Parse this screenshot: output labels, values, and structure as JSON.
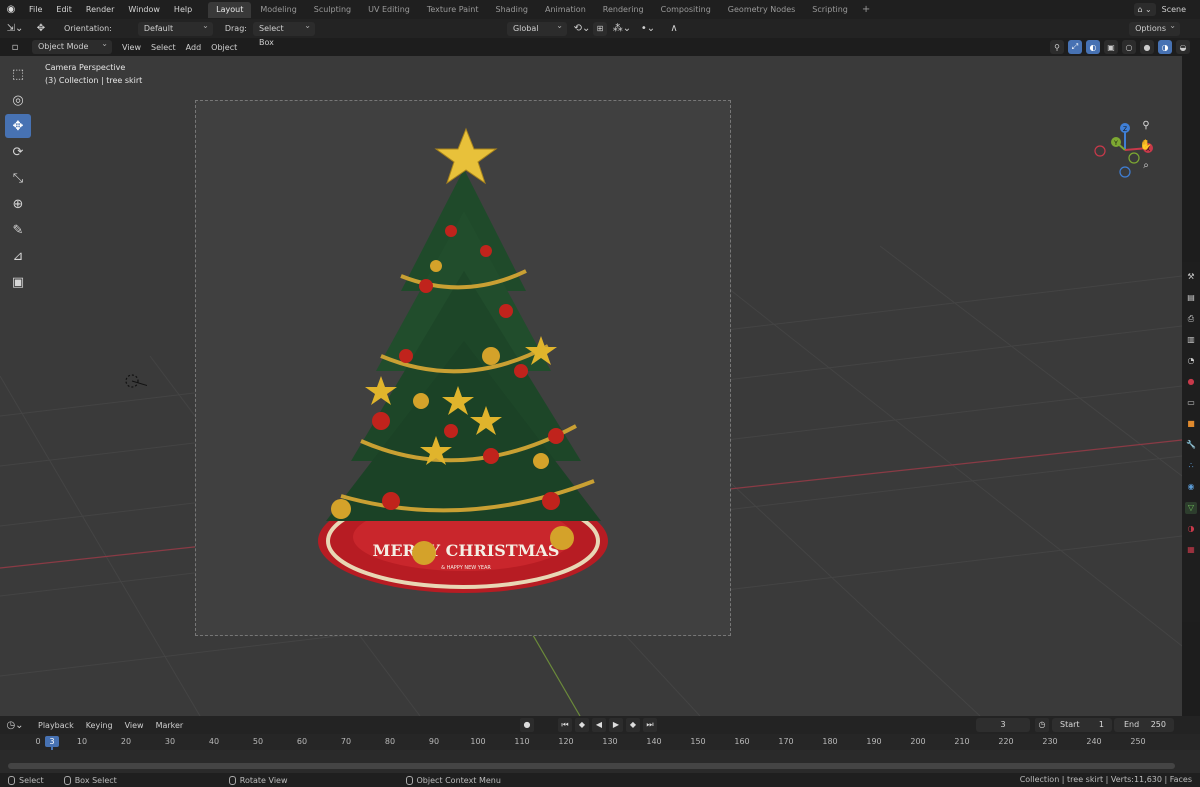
{
  "menu": {
    "items": [
      "File",
      "Edit",
      "Render",
      "Window",
      "Help"
    ]
  },
  "workspaces": {
    "tabs": [
      "Layout",
      "Modeling",
      "Sculpting",
      "UV Editing",
      "Texture Paint",
      "Shading",
      "Animation",
      "Rendering",
      "Compositing",
      "Geometry Nodes",
      "Scripting"
    ],
    "active": "Layout",
    "add": "+"
  },
  "scene": {
    "label": "Scene"
  },
  "tool_header": {
    "orientation_label": "Orientation:",
    "orientation_value": "Default",
    "drag_label": "Drag:",
    "drag_value": "Select Box",
    "transform_space": "Global",
    "options": "Options"
  },
  "viewport_header": {
    "mode": "Object Mode",
    "menus": [
      "View",
      "Select",
      "Add",
      "Object"
    ]
  },
  "viewport": {
    "camera_label": "Camera Perspective",
    "collection_label": "(3) Collection | tree skirt",
    "skirt_text": "MERRY CHRISTMAS",
    "skirt_subtext": "& HAPPY NEW YEAR"
  },
  "toolbar": {
    "tools": [
      "select-box-icon",
      "cursor-icon",
      "move-icon",
      "rotate-icon",
      "scale-icon",
      "transform-icon",
      "annotate-icon",
      "measure-icon",
      "add-cube-icon"
    ],
    "active": "move-icon"
  },
  "gizmo": {
    "x": "X",
    "y": "Y",
    "z": "Z"
  },
  "timeline": {
    "menus": [
      "Playback",
      "Keying",
      "View",
      "Marker"
    ],
    "current_frame": "3",
    "start_label": "Start",
    "start_value": "1",
    "end_label": "End",
    "end_value": "250",
    "ticks": [
      "0",
      "10",
      "20",
      "30",
      "40",
      "50",
      "60",
      "70",
      "80",
      "90",
      "100",
      "110",
      "120",
      "130",
      "140",
      "150",
      "160",
      "170",
      "180",
      "190",
      "200",
      "210",
      "220",
      "230",
      "240",
      "250"
    ]
  },
  "status": {
    "select": "Select",
    "box_select": "Box Select",
    "rotate_view": "Rotate View",
    "context_menu": "Object Context Menu",
    "stats": "Collection | tree skirt | Verts:11,630 | Faces"
  },
  "colors": {
    "accent": "#4772b3",
    "x_axis": "#c8394a",
    "y_axis": "#7da832",
    "z_axis": "#3f7fd6"
  }
}
